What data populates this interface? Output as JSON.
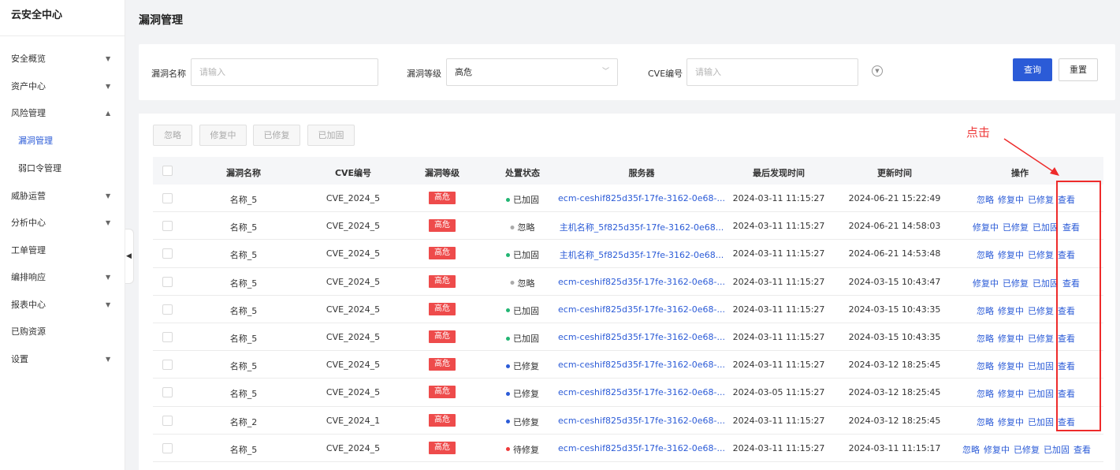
{
  "sidebar": {
    "brand": "云安全中心",
    "items": [
      {
        "label": "安全概览",
        "chevron": "▼"
      },
      {
        "label": "资产中心",
        "chevron": "▼"
      },
      {
        "label": "风险管理",
        "chevron": "▲"
      },
      {
        "label": "漏洞管理",
        "chevron": ""
      },
      {
        "label": "弱口令管理",
        "chevron": ""
      },
      {
        "label": "威胁运营",
        "chevron": "▼"
      },
      {
        "label": "分析中心",
        "chevron": "▼"
      },
      {
        "label": "工单管理",
        "chevron": ""
      },
      {
        "label": "编排响应",
        "chevron": "▼"
      },
      {
        "label": "报表中心",
        "chevron": "▼"
      },
      {
        "label": "已购资源",
        "chevron": ""
      },
      {
        "label": "设置",
        "chevron": "▼"
      }
    ]
  },
  "page": {
    "title": "漏洞管理"
  },
  "filters": {
    "name_label": "漏洞名称",
    "name_placeholder": "请输入",
    "level_label": "漏洞等级",
    "level_value": "高危",
    "cve_label": "CVE编号",
    "cve_placeholder": "请输入",
    "query": "查询",
    "reset": "重置"
  },
  "batch": {
    "ignore": "忽略",
    "fixing": "修复中",
    "fixed": "已修复",
    "hardened": "已加固"
  },
  "table": {
    "headers": {
      "name": "漏洞名称",
      "cve": "CVE编号",
      "level": "漏洞等级",
      "status": "处置状态",
      "server": "服务器",
      "last_found": "最后发现时间",
      "updated": "更新时间",
      "ops": "操作"
    },
    "rows": [
      {
        "name": "名称_5",
        "cve": "CVE_2024_5",
        "level": "高危",
        "status": "已加固",
        "status_color": "#22b573",
        "server": "ecm-ceshif825d35f-17fe-3162-0e68-...",
        "last_found": "2024-03-11 11:15:27",
        "updated": "2024-06-21 15:22:49",
        "ops": [
          "忽略",
          "修复中",
          "已修复",
          "查看"
        ]
      },
      {
        "name": "名称_5",
        "cve": "CVE_2024_5",
        "level": "高危",
        "status": "忽略",
        "status_color": "#aaaaaa",
        "server": "主机名称_5f825d35f-17fe-3162-0e68...",
        "last_found": "2024-03-11 11:15:27",
        "updated": "2024-06-21 14:58:03",
        "ops": [
          "修复中",
          "已修复",
          "已加固",
          "查看"
        ]
      },
      {
        "name": "名称_5",
        "cve": "CVE_2024_5",
        "level": "高危",
        "status": "已加固",
        "status_color": "#22b573",
        "server": "主机名称_5f825d35f-17fe-3162-0e68...",
        "last_found": "2024-03-11 11:15:27",
        "updated": "2024-06-21 14:53:48",
        "ops": [
          "忽略",
          "修复中",
          "已修复",
          "查看"
        ]
      },
      {
        "name": "名称_5",
        "cve": "CVE_2024_5",
        "level": "高危",
        "status": "忽略",
        "status_color": "#aaaaaa",
        "server": "ecm-ceshif825d35f-17fe-3162-0e68-...",
        "last_found": "2024-03-11 11:15:27",
        "updated": "2024-03-15 10:43:47",
        "ops": [
          "修复中",
          "已修复",
          "已加固",
          "查看"
        ]
      },
      {
        "name": "名称_5",
        "cve": "CVE_2024_5",
        "level": "高危",
        "status": "已加固",
        "status_color": "#22b573",
        "server": "ecm-ceshif825d35f-17fe-3162-0e68-...",
        "last_found": "2024-03-11 11:15:27",
        "updated": "2024-03-15 10:43:35",
        "ops": [
          "忽略",
          "修复中",
          "已修复",
          "查看"
        ]
      },
      {
        "name": "名称_5",
        "cve": "CVE_2024_5",
        "level": "高危",
        "status": "已加固",
        "status_color": "#22b573",
        "server": "ecm-ceshif825d35f-17fe-3162-0e68-...",
        "last_found": "2024-03-11 11:15:27",
        "updated": "2024-03-15 10:43:35",
        "ops": [
          "忽略",
          "修复中",
          "已修复",
          "查看"
        ]
      },
      {
        "name": "名称_5",
        "cve": "CVE_2024_5",
        "level": "高危",
        "status": "已修复",
        "status_color": "#2b5bd7",
        "server": "ecm-ceshif825d35f-17fe-3162-0e68-...",
        "last_found": "2024-03-11 11:15:27",
        "updated": "2024-03-12 18:25:45",
        "ops": [
          "忽略",
          "修复中",
          "已加固",
          "查看"
        ]
      },
      {
        "name": "名称_5",
        "cve": "CVE_2024_5",
        "level": "高危",
        "status": "已修复",
        "status_color": "#2b5bd7",
        "server": "ecm-ceshif825d35f-17fe-3162-0e68-...",
        "last_found": "2024-03-05 11:15:27",
        "updated": "2024-03-12 18:25:45",
        "ops": [
          "忽略",
          "修复中",
          "已加固",
          "查看"
        ]
      },
      {
        "name": "名称_2",
        "cve": "CVE_2024_1",
        "level": "高危",
        "status": "已修复",
        "status_color": "#2b5bd7",
        "server": "ecm-ceshif825d35f-17fe-3162-0e68-...",
        "last_found": "2024-03-11 11:15:27",
        "updated": "2024-03-12 18:25:45",
        "ops": [
          "忽略",
          "修复中",
          "已加固",
          "查看"
        ]
      },
      {
        "name": "名称_5",
        "cve": "CVE_2024_5",
        "level": "高危",
        "status": "待修复",
        "status_color": "#ee3a3a",
        "server": "ecm-ceshif825d35f-17fe-3162-0e68-...",
        "last_found": "2024-03-11 11:15:27",
        "updated": "2024-03-11 11:15:17",
        "ops": [
          "忽略",
          "修复中",
          "已修复",
          "已加固",
          "查看"
        ]
      }
    ]
  },
  "annotation": {
    "text": "点击",
    "color": "#ee2b2b"
  }
}
